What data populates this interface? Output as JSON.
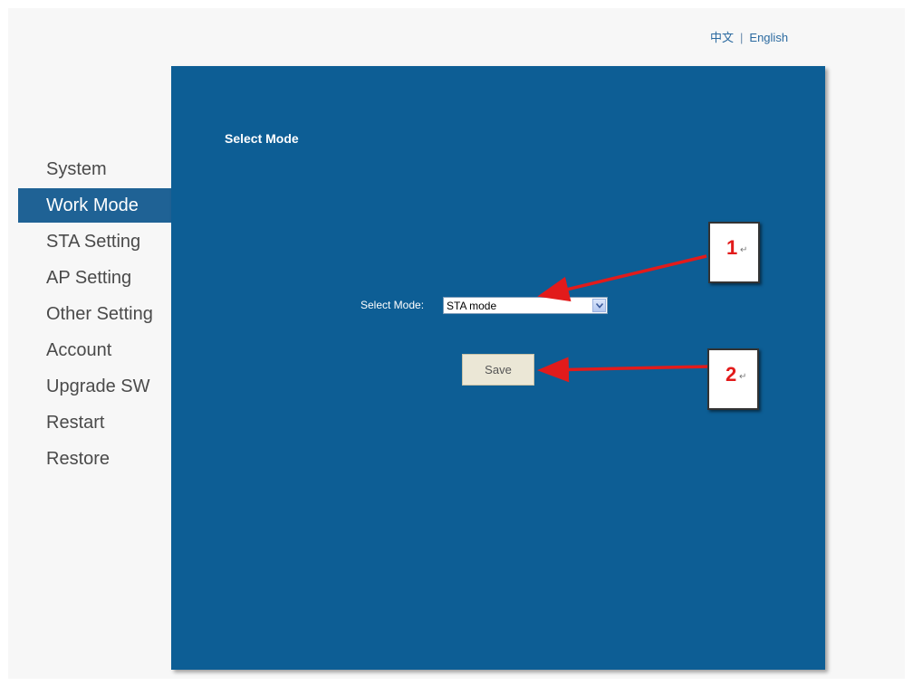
{
  "language": {
    "chinese": "中文",
    "separator": "|",
    "english": "English"
  },
  "sidebar": {
    "items": [
      {
        "label": "System",
        "active": false
      },
      {
        "label": "Work Mode",
        "active": true
      },
      {
        "label": "STA Setting",
        "active": false
      },
      {
        "label": "AP Setting",
        "active": false
      },
      {
        "label": "Other Setting",
        "active": false
      },
      {
        "label": "Account",
        "active": false
      },
      {
        "label": "Upgrade SW",
        "active": false
      },
      {
        "label": "Restart",
        "active": false
      },
      {
        "label": "Restore",
        "active": false
      }
    ]
  },
  "panel": {
    "title": "Select Mode",
    "mode_label": "Select Mode:",
    "mode_value": "STA mode",
    "save_label": "Save"
  },
  "annotations": {
    "callout_1": "1",
    "callout_2": "2",
    "return_mark": "↵",
    "arrow_color": "#e21b1b"
  },
  "colors": {
    "panel_bg": "#0d5e95",
    "active_nav_bg": "#1f6295",
    "link": "#2b6aa0"
  }
}
